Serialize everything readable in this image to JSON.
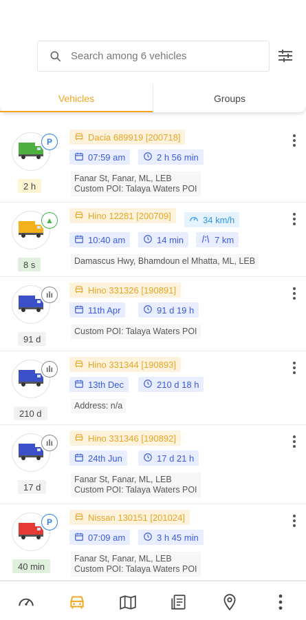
{
  "search": {
    "placeholder": "Search among 6 vehicles"
  },
  "tabs": [
    {
      "label": "Vehicles"
    },
    {
      "label": "Groups"
    }
  ],
  "colors": {
    "accent": "#f0a51d",
    "chip_blue": "#3b5bd9",
    "parked": "#2f7fe0",
    "moving": "#3cb64a"
  },
  "vehicles": [
    {
      "name": "Dacia 689919 [200718]",
      "time": "07:59 am",
      "duration": "2 h 56 min",
      "tag": "2 h",
      "status_icon": "parked-p-icon",
      "badge": "P",
      "truck_color": "#4caf3e",
      "addr1": "Fanar St, Fanar, ML, LEB",
      "addr2": "Custom POI: Talaya Waters POI"
    },
    {
      "name": "Hino 12281 [200709]",
      "speed": "34 km/h",
      "time": "10:40 am",
      "duration": "14 min",
      "distance": "7 km",
      "tag": "8 s",
      "status_icon": "moving-arrow-icon",
      "badge": "▲",
      "truck_color": "#f3b21b",
      "addr1": "Damascus Hwy, Bhamdoun el Mhatta, ML, LEB"
    },
    {
      "name": "Hino 331326 [190891]",
      "time": "11th Apr",
      "duration": "91 d 19 h",
      "tag": "91 d",
      "status_icon": "idle-bars-icon",
      "badge": "ılı",
      "truck_color": "#3b4fc9",
      "addr1": "Custom POI: Talaya Waters POI"
    },
    {
      "name": "Hino 331344 [190893]",
      "time": "13th Dec",
      "duration": "210 d 18 h",
      "tag": "210 d",
      "status_icon": "idle-bars-icon",
      "badge": "ılı",
      "truck_color": "#3b4fc9",
      "addr1": "Address: n/a"
    },
    {
      "name": "Hino 331346 [190892]",
      "time": "24th Jun",
      "duration": "17 d 21 h",
      "tag": "17 d",
      "status_icon": "idle-bars-icon",
      "badge": "ılı",
      "truck_color": "#3b4fc9",
      "addr1": "Fanar St, Fanar, ML, LEB",
      "addr2": "Custom POI: Talaya Waters POI"
    },
    {
      "name": "Nissan 130151 [201024]",
      "time": "07:09 am",
      "duration": "3 h 45 min",
      "tag": "40 min",
      "status_icon": "parked-p-icon",
      "badge": "P",
      "truck_color": "#e53935",
      "addr1": "Fanar St, Fanar, ML, LEB",
      "addr2": "Custom POI: Talaya Waters POI"
    }
  ],
  "bottom_nav": [
    {
      "icon": "dashboard-gauge-icon"
    },
    {
      "icon": "vehicle-car-icon",
      "active": true
    },
    {
      "icon": "map-icon"
    },
    {
      "icon": "reports-icon"
    },
    {
      "icon": "location-pin-icon"
    },
    {
      "icon": "more-vertical-icon"
    }
  ]
}
